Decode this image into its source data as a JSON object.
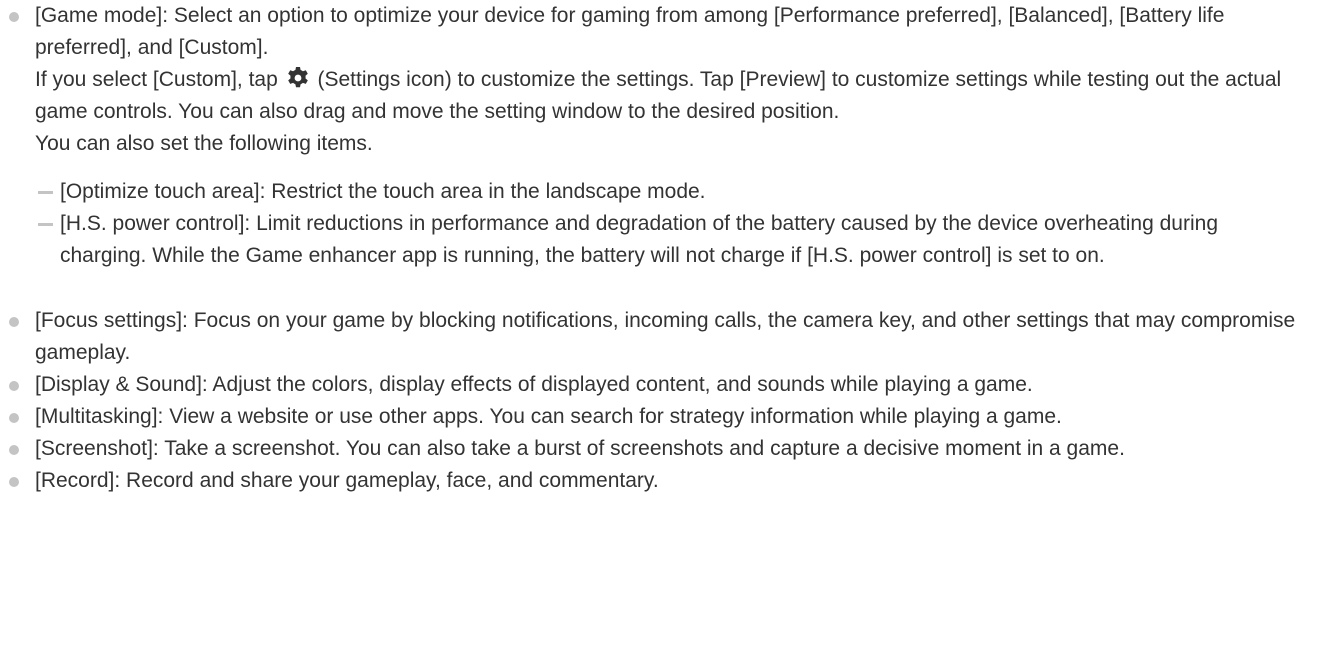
{
  "items": [
    {
      "text": "[Game mode]: Select an option to optimize your device for gaming from among [Performance preferred], [Balanced], [Battery life preferred], and [Custom].",
      "custom_before_icon": "If you select [Custom], tap",
      "custom_after_icon": "(Settings icon) to customize the settings. Tap [Preview] to customize settings while testing out the actual game controls. You can also drag and move the setting window to the desired position.",
      "also_text": "You can also set the following items.",
      "subitems": [
        "[Optimize touch area]: Restrict the touch area in the landscape mode.",
        "[H.S. power control]: Limit reductions in performance and degradation of the battery caused by the device overheating during charging. While the Game enhancer app is running, the battery will not charge if [H.S. power control] is set to on."
      ]
    },
    {
      "text": "[Focus settings]: Focus on your game by blocking notifications, incoming calls, the camera key, and other settings that may compromise gameplay."
    },
    {
      "text": "[Display & Sound]: Adjust the colors, display effects of displayed content, and sounds while playing a game."
    },
    {
      "text": "[Multitasking]: View a website or use other apps. You can search for strategy information while playing a game."
    },
    {
      "text": "[Screenshot]: Take a screenshot. You can also take a burst of screenshots and capture a decisive moment in a game."
    },
    {
      "text": "[Record]: Record and share your gameplay, face, and commentary."
    }
  ],
  "icons": {
    "settings": "gear-icon"
  },
  "colors": {
    "text": "#333333",
    "bullet": "#c4c4c4",
    "icon": "#333333"
  }
}
